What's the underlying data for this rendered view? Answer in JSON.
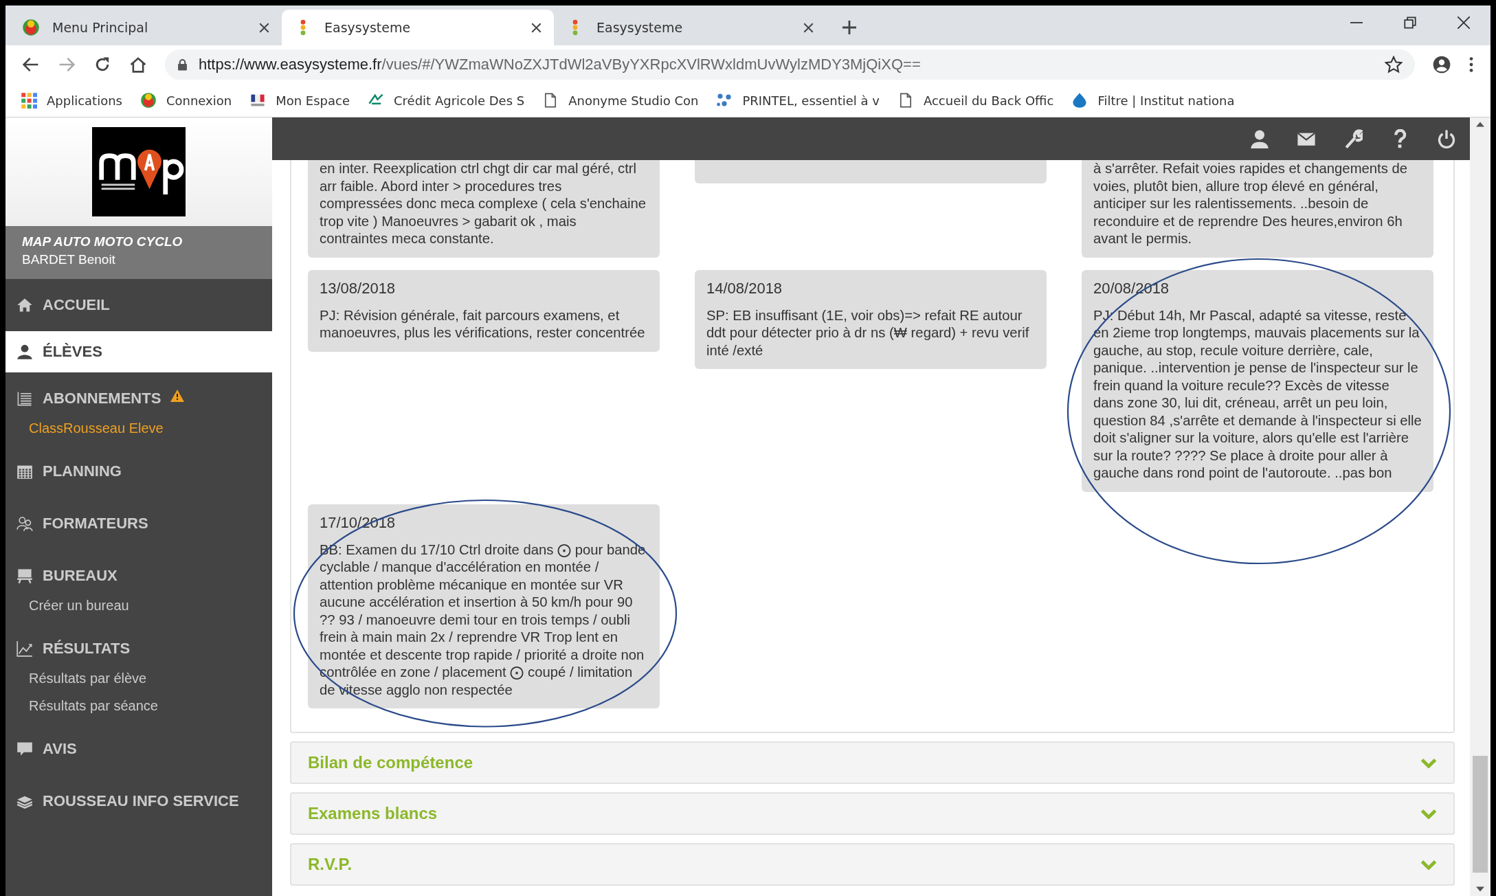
{
  "browser": {
    "tabs": [
      {
        "title": "Menu Principal",
        "selected": false
      },
      {
        "title": "Easysysteme",
        "selected": true
      },
      {
        "title": "Easysysteme",
        "selected": false
      }
    ],
    "url": {
      "host": "https://www.easysysteme.fr",
      "path": "/vues/#/YWZmaWNoZXJTdWl2aVByYXRpcXVlRWxldmUvWylzMDY3MjQiXQ=="
    },
    "bookmarks": [
      {
        "label": "Applications"
      },
      {
        "label": "Connexion"
      },
      {
        "label": "Mon Espace"
      },
      {
        "label": "Crédit Agricole Des S"
      },
      {
        "label": "Anonyme Studio Con"
      },
      {
        "label": "PRINTEL, essentiel à v"
      },
      {
        "label": "Accueil du Back Offic"
      },
      {
        "label": "Filtre | Institut nationa"
      }
    ]
  },
  "sidebar": {
    "company": "MAP AUTO MOTO CYCLO",
    "user": "BARDET Benoit",
    "items": [
      {
        "kind": "section",
        "label": "ACCUEIL",
        "selected": false,
        "warning": false
      },
      {
        "kind": "section",
        "label": "ÉLÈVES",
        "selected": true,
        "warning": false
      },
      {
        "kind": "section",
        "label": "ABONNEMENTS",
        "selected": false,
        "warning": true
      },
      {
        "kind": "sub",
        "label": "ClassRousseau Eleve",
        "highlight": true
      },
      {
        "kind": "section",
        "label": "PLANNING",
        "selected": false,
        "warning": false
      },
      {
        "kind": "section",
        "label": "FORMATEURS",
        "selected": false,
        "warning": false
      },
      {
        "kind": "section",
        "label": "BUREAUX",
        "selected": false,
        "warning": false
      },
      {
        "kind": "sub",
        "label": "Créer un bureau",
        "highlight": false
      },
      {
        "kind": "section",
        "label": "RÉSULTATS",
        "selected": false,
        "warning": false
      },
      {
        "kind": "sub",
        "label": "Résultats par élève",
        "highlight": false
      },
      {
        "kind": "sub",
        "label": "Résultats par séance",
        "highlight": false
      },
      {
        "kind": "section",
        "label": "AVIS",
        "selected": false,
        "warning": false
      },
      {
        "kind": "section",
        "label": "ROUSSEAU INFO SERVICE",
        "selected": false,
        "warning": false
      }
    ]
  },
  "cards": [
    {
      "text": "en inter. Reexplication ctrl chgt dir car mal géré, ctrl arr faible. Abord inter > procedures tres compressées donc meca complexe ( cela s'enchaine trop vite ) Manoeuvres > gabarit ok , mais contraintes meca constante.",
      "annotated": false
    },
    {
      "annotated": false
    },
    {
      "text": "à s'arrêter. Refait voies rapides et changements de voies, plutôt bien, allure trop élevé en général, anticiper sur les ralentissements. ..besoin de reconduire et de reprendre Des heures,environ 6h avant le permis.",
      "annotated": false
    },
    {
      "date": "13/08/2018",
      "text": "PJ: Révision générale, fait parcours examens, et manoeuvres, plus les vérifications, rester concentrée",
      "annotated": false
    },
    {
      "date": "14/08/2018",
      "text": "SP: EB insuffisant (1E, voir obs)=> refait RE autour ddt pour détecter prio à dr ns (₩ regard) + revu verif inté /exté",
      "annotated": false
    },
    {
      "date": "20/08/2018",
      "text": "PJ: Début 14h, Mr Pascal, adapté sa vitesse, reste en 2ieme trop longtemps, mauvais placements sur la gauche, au stop, recule voiture derrière, cale, panique. ..intervention je pense de l'inspecteur sur le frein quand la voiture recule?? Excès de vitesse dans zone 30, lui dit, créneau, arrêt un peu loin, question 84 ,s'arrête et demande à l'inspecteur si elle doit s'aligner sur la voiture, alors qu'elle est l'arrière sur la route? ???? Se place à droite pour aller à gauche dans rond point de l'autoroute. ..pas bon",
      "annotated": true
    },
    {
      "date": "17/10/2018",
      "text": "BB: Examen du 17/10 Ctrl droite dans ⨀ pour bande cyclable / manque d'accélération en montée / attention problème mécanique en montée sur VR aucune accélération et insertion à 50 km/h pour 90 ?? 93 / manoeuvre demi tour en trois temps / oubli frein à main main 2x / reprendre VR Trop lent en montée et descente trop rapide / priorité a droite non contrôlée en zone / placement ⨀ coupé / limitation de vitesse agglo non respectée",
      "annotated": true
    }
  ],
  "sections": [
    {
      "title": "Bilan de compétence",
      "expanded": false
    },
    {
      "title": "Examens blancs",
      "expanded": false
    },
    {
      "title": "R.V.P.",
      "expanded": false
    }
  ]
}
